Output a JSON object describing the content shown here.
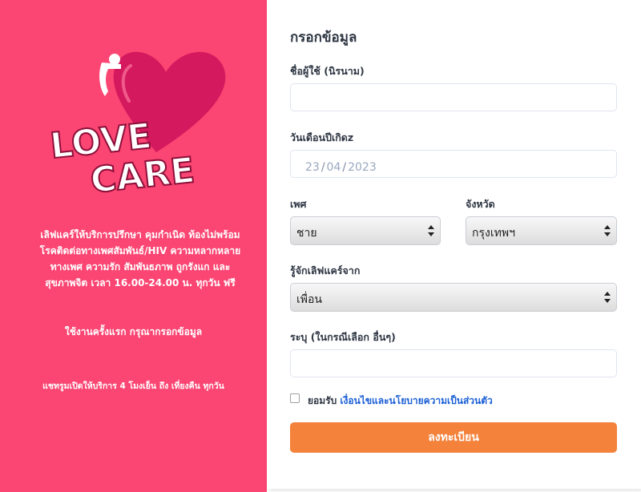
{
  "brand": {
    "logo_line1": "LOVE",
    "logo_line2": "CARE",
    "colors": {
      "panel": "#fb4572",
      "heart": "#d5195e",
      "heart_light": "#f05a8a",
      "button": "#f4823b",
      "link": "#1b5fd6"
    }
  },
  "left_panel": {
    "promo_lines": [
      "เลิฟแคร์ให้บริการปรึกษา คุมกำเนิด ท้องไม่พร้อม",
      "โรคติดต่อทางเพศสัมพันธ์/HIV ความหลากหลาย",
      "ทางเพศ ความรัก สัมพันธภาพ ถูกรังแก และ",
      "สุขภาพจิต เวลา 16.00-24.00 น. ทุกวัน ฟรี"
    ],
    "first_use": "ใช้งานครั้งแรก กรุณากรอกข้อมูล",
    "hours": "แชทรูมเปิดให้บริการ 4 โมงเย็น ถึง เที่ยงคืน ทุกวัน"
  },
  "form": {
    "title": "กรอกข้อมูล",
    "nickname": {
      "label": "ชื่อผู้ใช้ (นิรนาม)",
      "value": ""
    },
    "birthdate": {
      "label": "วันเดือนปีเกิดz",
      "day": "23",
      "month": "04",
      "year": "2023"
    },
    "gender": {
      "label": "เพศ",
      "selected": "ชาย"
    },
    "province": {
      "label": "จังหวัด",
      "selected": "กรุงเทพฯ"
    },
    "referral": {
      "label": "รู้จักเลิฟแคร์จาก",
      "selected": "เพื่อน"
    },
    "other": {
      "label": "ระบุ (ในกรณีเลือก อื่นๆ)",
      "value": ""
    },
    "consent": {
      "prefix": "ยอมรับ",
      "link": "เงื่อนไขและนโยบายความเป็นส่วนตัว",
      "checked": false
    },
    "submit_label": "ลงทะเบียน"
  }
}
